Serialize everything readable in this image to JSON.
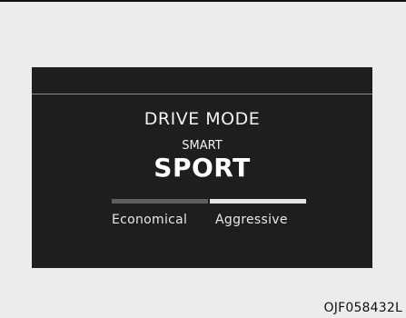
{
  "display": {
    "title": "DRIVE MODE",
    "submode": "SMART",
    "mode": "SPORT",
    "scale_left": "Economical",
    "scale_right": "Aggressive",
    "position": "aggressive"
  },
  "figure": {
    "code": "OJF058432L"
  },
  "colors": {
    "screen_background": "#1e1e1e",
    "panel_background": "#ececec",
    "text": "#f2f2f2",
    "inactive_bar": "#5f5f5f",
    "active_bar": "#e4e4e4"
  }
}
